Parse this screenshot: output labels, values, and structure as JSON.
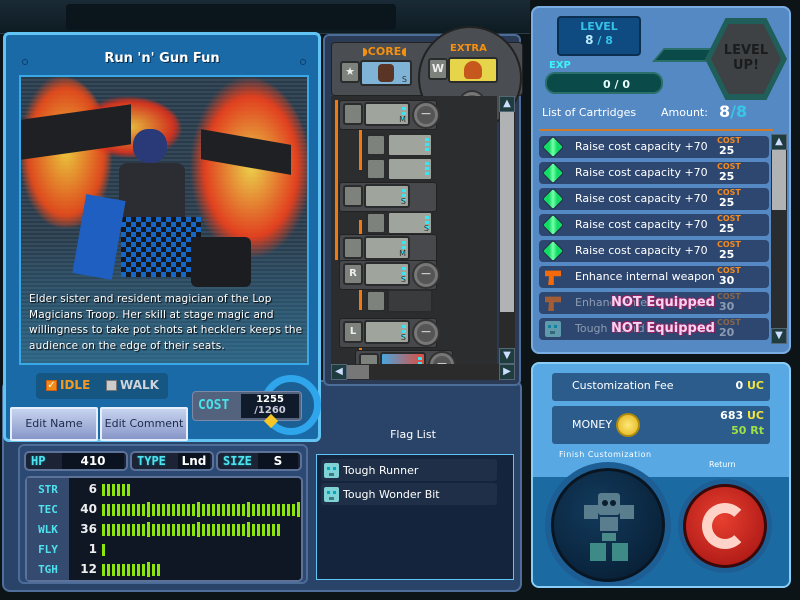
{
  "character": {
    "title": "Run 'n' Gun Fun",
    "description": "Elder sister and resident magician of the Lop Magicians Troop. Her skill at stage magic and willingness to take pot shots at hecklers keeps the audience on the edge of their seats.",
    "motion": {
      "idle_label": "IDLE",
      "walk_label": "WALK",
      "idle_checked": true,
      "walk_checked": false
    },
    "buttons": {
      "edit_name": "Edit Name",
      "edit_comment": "Edit Comment"
    },
    "cost": {
      "label": "COST",
      "current": "1255",
      "max": "/1260",
      "fraction": 0.996
    }
  },
  "stats": {
    "hp_label": "HP",
    "hp": "410",
    "type_label": "TYPE",
    "type": "Lnd",
    "size_label": "SIZE",
    "size": "S",
    "rows": [
      {
        "label": "STR",
        "value": 6
      },
      {
        "label": "TEC",
        "value": 40
      },
      {
        "label": "WLK",
        "value": 36
      },
      {
        "label": "FLY",
        "value": 1
      },
      {
        "label": "TGH",
        "value": 12
      }
    ]
  },
  "parts": {
    "core_label": "CORE",
    "extra_label": "EXTRA",
    "core_size": "S",
    "slots": [
      {
        "slot": "head",
        "size": "M"
      },
      {
        "slot": "accessory-head",
        "size": ""
      },
      {
        "slot": "accessory-face",
        "size": ""
      },
      {
        "slot": "legs",
        "size": "S"
      },
      {
        "slot": "leg-arm",
        "size": "S"
      },
      {
        "slot": "arm",
        "size": "M"
      },
      {
        "slot": "right-hand",
        "size": "S",
        "tag": "R"
      },
      {
        "slot": "right-weapon",
        "size": ""
      },
      {
        "slot": "left-hand",
        "size": "S",
        "tag": "L"
      },
      {
        "slot": "left-weapon",
        "size": ""
      }
    ]
  },
  "flags": {
    "title": "Flag List",
    "items": [
      "Tough Runner",
      "Tough Wonder Bit"
    ]
  },
  "level": {
    "label": "LEVEL",
    "current": "8",
    "max": "/ 8",
    "exp_label": "EXP",
    "exp": "0 / 0",
    "level_up_line1": "LEVEL",
    "level_up_line2": "UP!"
  },
  "cartridges": {
    "header": "List of Cartridges",
    "amount_label": "Amount:",
    "amount_current": "8",
    "amount_max": "/8",
    "cost_label": "COST",
    "not_equipped": "NOT Equipped",
    "items": [
      {
        "name": "Raise cost capacity +70",
        "cost": "25",
        "icon": "capacity",
        "equipped": true
      },
      {
        "name": "Raise cost capacity +70",
        "cost": "25",
        "icon": "capacity",
        "equipped": true
      },
      {
        "name": "Raise cost capacity +70",
        "cost": "25",
        "icon": "capacity",
        "equipped": true
      },
      {
        "name": "Raise cost capacity +70",
        "cost": "25",
        "icon": "capacity",
        "equipped": true
      },
      {
        "name": "Raise cost capacity +70",
        "cost": "25",
        "icon": "capacity",
        "equipped": true
      },
      {
        "name": "Enhance internal weapon",
        "cost": "30",
        "icon": "weapon",
        "equipped": true
      },
      {
        "name": "Enhance internal weapon",
        "cost": "30",
        "icon": "weapon",
        "equipped": false
      },
      {
        "name": "Tough Guard",
        "cost": "20",
        "icon": "robot",
        "equipped": false
      }
    ]
  },
  "finish": {
    "fee_label": "Customization Fee",
    "fee_value": "0",
    "fee_unit": "UC",
    "money_label": "MONEY",
    "money_uc": "683",
    "money_uc_unit": "UC",
    "money_rt": "50",
    "money_rt_unit": "Rt",
    "finish_label": "Finish Customization",
    "return_label": "Return"
  }
}
